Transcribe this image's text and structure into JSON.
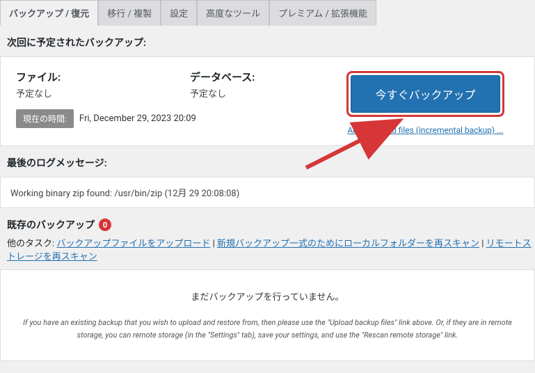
{
  "tabs": [
    {
      "label": "バックアップ / 復元",
      "active": true
    },
    {
      "label": "移行 / 複製",
      "active": false
    },
    {
      "label": "設定",
      "active": false
    },
    {
      "label": "高度なツール",
      "active": false
    },
    {
      "label": "プレミアム / 拡張機能",
      "active": false
    }
  ],
  "scheduled": {
    "title": "次回に予定されたバックアップ:",
    "file_label": "ファイル:",
    "file_value": "予定なし",
    "db_label": "データベース:",
    "db_value": "予定なし",
    "time_badge": "現在の時間:",
    "time_value": "Fri, December 29, 2023 20:09",
    "backup_now": "今すぐバックアップ",
    "add_changed": "Add changed files (incremental backup) ..."
  },
  "log": {
    "title": "最後のログメッセージ:",
    "message": "Working binary zip found: /usr/bin/zip (12月 29 20:08:08)"
  },
  "existing": {
    "title": "既存のバックアップ",
    "count": "0",
    "tasks_label": "他のタスク: ",
    "upload_link": "バックアップファイルをアップロード",
    "rescan_local": "新規バックアップ一式のためにローカルフォルダーを再スキャン",
    "rescan_remote": "リモートストレージを再スキャン",
    "sep": " | ",
    "empty_msg": "まだバックアップを行っていません。",
    "empty_hint": "If you have an existing backup that you wish to upload and restore from, then please use the \"Upload backup files\" link above. Or, if they are in remote storage, you can remote storage (in the \"Settings\" tab), save your settings, and use the \"Rescan remote storage\" link."
  }
}
